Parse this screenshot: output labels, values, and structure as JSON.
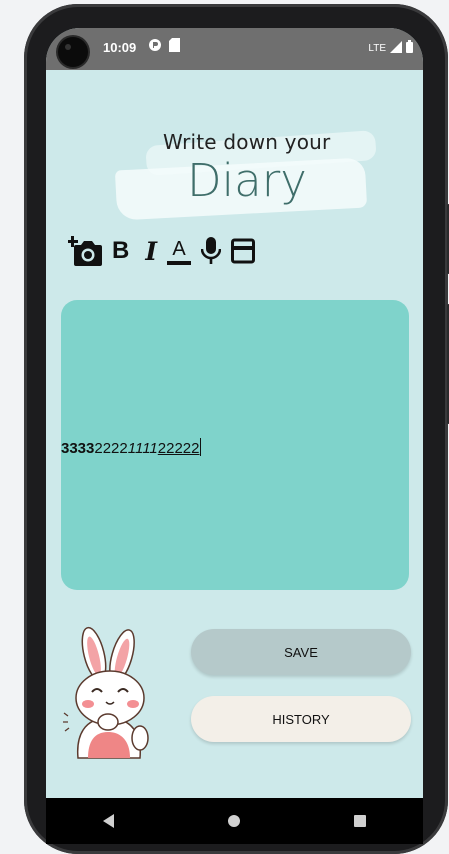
{
  "status_bar": {
    "time": "10:09",
    "network": "LTE",
    "icons": [
      "lens-icon",
      "sd-card-icon",
      "signal-icon",
      "battery-icon"
    ]
  },
  "header": {
    "line1": "Write down  your",
    "line2": "Diary"
  },
  "toolbar": {
    "tools": [
      "add-photo-icon",
      "bold-icon",
      "italic-icon",
      "text-color-icon",
      "microphone-icon",
      "card-icon"
    ],
    "bold_glyph": "B",
    "italic_glyph": "I",
    "color_glyph": "A"
  },
  "editor": {
    "bold_text": "3333",
    "plain_text": "2222",
    "italic_text": "1111",
    "underline_text": "22222"
  },
  "buttons": {
    "save_label": "SAVE",
    "history_label": "HISTORY"
  },
  "nav": {
    "icons": [
      "back-icon",
      "home-icon",
      "recents-icon"
    ]
  },
  "colors": {
    "background": "#cde9ea",
    "editor": "#7fd3cb",
    "save_button": "#b5c9ca",
    "history_button": "#f3efe8",
    "title_accent": "#3f6e6a"
  }
}
